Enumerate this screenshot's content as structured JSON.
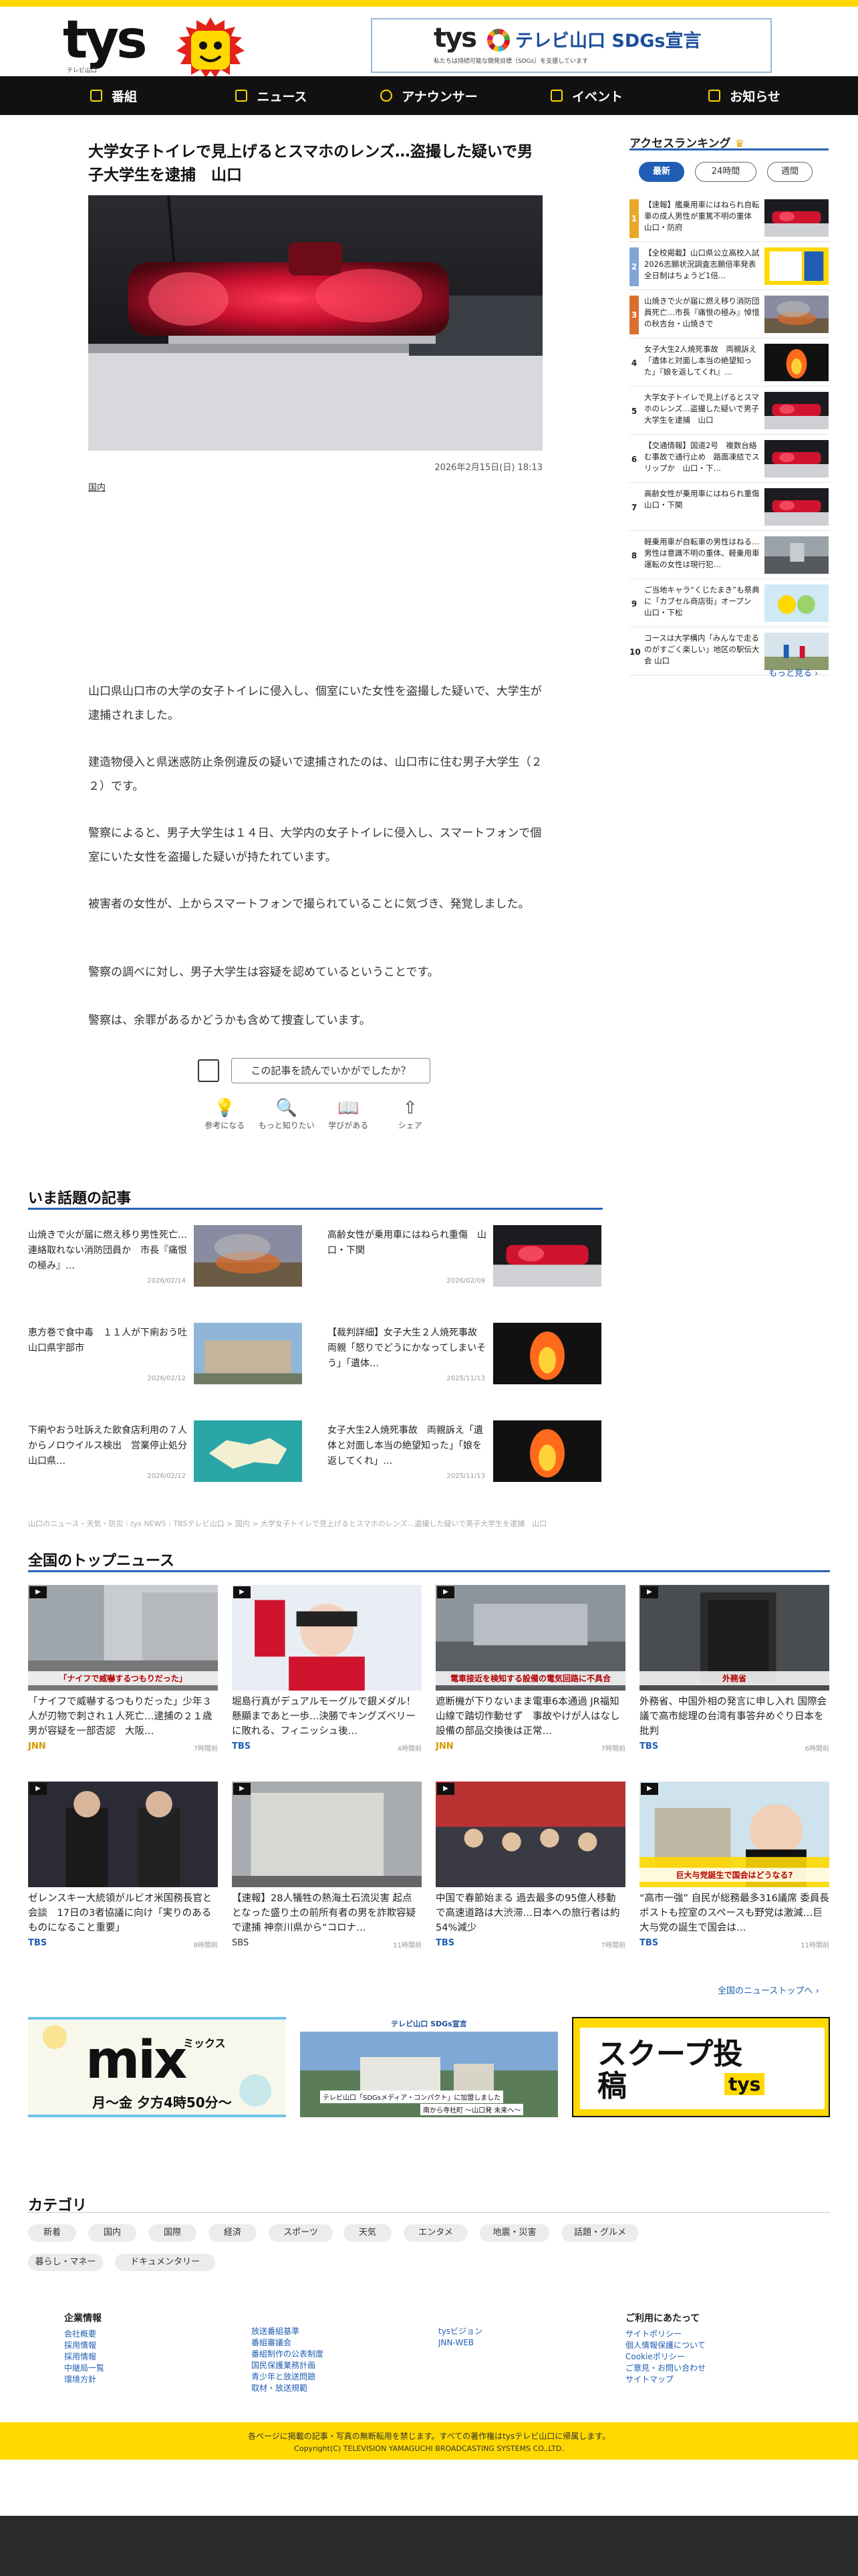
{
  "header": {
    "logo": "tys",
    "logo_sub": "テレビ山口",
    "sdgs": {
      "logo": "tys",
      "title": "テレビ山口 SDGs宣言",
      "small": "私たちは持続可能な開発目標（SDGs）を支援しています"
    }
  },
  "nav": [
    {
      "label": "番組",
      "icon": "tv-icon"
    },
    {
      "label": "ニュース",
      "icon": "news-icon"
    },
    {
      "label": "アナウンサー",
      "icon": "mic-icon"
    },
    {
      "label": "イベント",
      "icon": "megaphone-icon"
    },
    {
      "label": "お知らせ",
      "icon": "bell-icon"
    }
  ],
  "article": {
    "title": "大学女子トイレで見上げるとスマホのレンズ…盗撮した疑いで男子大学生を逮捕　山口",
    "date": "2026年2月15日(日) 18:13",
    "tag": "国内",
    "paragraphs": [
      "山口県山口市の大学の女子トイレに侵入し、個室にいた女性を盗撮した疑いで、大学生が逮捕されました。",
      "建造物侵入と県迷惑防止条例違反の疑いで逮捕されたのは、山口市に住む男子大学生（２２）です。",
      "警察によると、男子大学生は１４日、大学内の女子トイレに侵入し、スマートフォンで個室にいた女性を盗撮した疑いが持たれています。",
      "被害者の女性が、上からスマートフォンで撮られていることに気づき、発覚しました。",
      "警察の調べに対し、男子大学生は容疑を認めているということです。",
      "警察は、余罪があるかどうかも含めて捜査しています。"
    ],
    "survey_label": "この記事を読んでいかがでしたか？",
    "reactions": [
      {
        "label": "参考になる",
        "glyph": "💡",
        "icon": "bulb-icon"
      },
      {
        "label": "もっと知りたい",
        "glyph": "🔍",
        "icon": "magnifier-icon"
      },
      {
        "label": "学びがある",
        "glyph": "📖",
        "icon": "book-icon"
      },
      {
        "label": "シェア",
        "glyph": "⇧",
        "icon": "share-icon"
      }
    ]
  },
  "ranking": {
    "title": "アクセスランキング",
    "tabs": [
      "最新",
      "24時間",
      "週間"
    ],
    "active_tab": "最新",
    "items": [
      {
        "num": "1",
        "text": "【速報】艦乗用車にはねられ自転車の成人男性が重篤不明の重体　山口・防府",
        "thumb": "police"
      },
      {
        "num": "2",
        "text": "【全校掲載】山口県公立高校入試2026志願状況調査志願倍率発表 全日制はちょうど1倍…",
        "thumb": "school"
      },
      {
        "num": "3",
        "text": "山焼きで火が届に燃え移り消防団員死亡…市長『痛恨の極み』悼惜の秋吉台・山焼きで",
        "thumb": "fire"
      },
      {
        "num": "4",
        "text": "女子大生2人焼死事故　両親訴え「遺体と対面し本当の絶望知った」『娘を返してくれ』…",
        "thumb": "fire2"
      },
      {
        "num": "5",
        "text": "大学女子トイレで見上げるとスマホのレンズ…盗撮した疑いで男子大学生を逮捕　山口",
        "thumb": "police"
      },
      {
        "num": "6",
        "text": "【交通情報】国道2号　複数台絡む事故で通行止め　路面凍結でスリップか　山口・下…",
        "thumb": "police"
      },
      {
        "num": "7",
        "text": "高齢女性が乗用車にはねられ重傷　山口・下関",
        "thumb": "police"
      },
      {
        "num": "8",
        "text": "軽乗用車が自転車の男性はねる…男性は意識不明の重体、軽乗用車運転の女性は現行犯…",
        "thumb": "road"
      },
      {
        "num": "9",
        "text": "ご当地キャラ“くじたまき”も祭典に「カブセル商店街」オープン　山口・下松",
        "thumb": "mascot"
      },
      {
        "num": "10",
        "text": "コースは大学構内「みんなで走るのがすごく楽しい」地区の駅伝大会 山口",
        "thumb": "run"
      }
    ],
    "more": "もっと見る ›"
  },
  "wadai": {
    "title": "いま話題の記事",
    "items": [
      {
        "text": "山焼きで火が届に燃え移り男性死亡…連絡取れない消防団員か　市長『痛恨の極み』…",
        "date": "2026/02/14",
        "thumb": "fire"
      },
      {
        "text": "高齢女性が乗用車にはねられ重傷　山口・下関",
        "date": "2026/02/09",
        "thumb": "police"
      },
      {
        "text": "恵方巻で食中毒　１１人が下痢おう吐　山口県宇部市",
        "date": "2026/02/12",
        "thumb": "building"
      },
      {
        "text": "【裁判詳細】女子大生２人焼死事故　両親「怒りでどうにかなってしまいそう」「遺体…",
        "date": "2025/11/13",
        "thumb": "fire2"
      },
      {
        "text": "下痢やおう吐訴えた飲食店利用の７人からノロウイルス検出　営業停止処分　山口県…",
        "date": "2026/02/12",
        "thumb": "map"
      },
      {
        "text": "女子大生2人焼死事故　両親訴え「遺体と対面し本当の絶望知った」「娘を返してくれ」…",
        "date": "2025/11/13",
        "thumb": "fire2"
      }
    ]
  },
  "breadcrumb": "山口のニュース・天気・防災｜tys NEWS｜TBSテレビ山口 > 国内 > 大学女子トイレで見上げるとスマホのレンズ…盗撮した疑いで男子大学生を逮捕　山口",
  "topnews": {
    "title": "全国のトップニュース",
    "items": [
      {
        "text": "「ナイフで威嚇するつもりだった」少年３人が刃物で刺され１人死亡…逮捕の２１歳男が容疑を一部否認　大阪…",
        "source": "JNN",
        "time": "7時間前",
        "thumb": "street",
        "caption": "「ナイフで威嚇するつもりだった」"
      },
      {
        "text": "堀島行真がデュアルモーグルで銀メダル！懸顯まであと一歩…決勝でキングズベリーに敗れる、フィニッシュ後…",
        "source": "TBS",
        "time": "4時間前",
        "thumb": "skier",
        "caption": ""
      },
      {
        "text": "遮断機が下りないまま電車6本通過 JR福知山線で踏切作動せず　事故やけが人はなし　設備の部品交換後は正常…",
        "source": "JNN",
        "time": "7時間前",
        "thumb": "rail",
        "caption": "電車接近を検知する設備の電気回路に不具合"
      },
      {
        "text": "外務省、中国外相の発言に申し入れ 国際会議で高市総理の台湾有事答弁めぐり日本を批判",
        "source": "TBS",
        "time": "6時間前",
        "thumb": "mofa",
        "caption": "外務省"
      },
      {
        "text": "ゼレンスキー大統領がルビオ米国務長官と会談　17日の3者協議に向け「実りのあるものになること重要」",
        "source": "TBS",
        "time": "8時間前",
        "thumb": "meeting",
        "caption": ""
      },
      {
        "text": "【速報】28人犠牲の熱海土石流災害 起点となった盛り土の前所有者の男を詐欺容疑で逮捕 神奈川県から“コロナ…",
        "source": "SBS",
        "time": "11時間前",
        "thumb": "office",
        "caption": ""
      },
      {
        "text": "中国で春節始まる 過去最多の95億人移動で高速道路は大渋滞…日本への旅行者は約54%減少",
        "source": "TBS",
        "time": "7時間前",
        "thumb": "crowd",
        "caption": ""
      },
      {
        "text": "“高市一強” 自民が総務最多316議席 委員長ポストも控室のスペースも野党は激減…巨大与党の誕生で国会は…",
        "source": "TBS",
        "time": "11時間前",
        "thumb": "diet",
        "caption": "巨大与党誕生で国会はどうなる?"
      }
    ],
    "more": "全国のニューストップへ ›"
  },
  "banners": {
    "mix": {
      "title": "mix",
      "sub": "ミックス",
      "time": "月〜金 夕方4時50分〜"
    },
    "sdgs": {
      "title": "テレビ山口 SDGs宣言",
      "caption": "テレビ山口「SDGsメディア・コンパクト」に加盟しました",
      "note": "南から寺社町 〜山口発 未来へ〜"
    },
    "scoop": {
      "title": "スクープ投稿",
      "logo": "tys"
    }
  },
  "category": {
    "title": "カテゴリ",
    "items": [
      "新着",
      "国内",
      "国際",
      "経済",
      "スポーツ",
      "天気",
      "エンタメ",
      "地震・災害",
      "話題・グルメ",
      "暮らし・マネー",
      "ドキュメンタリー"
    ]
  },
  "footer": {
    "col1": {
      "head": "企業情報",
      "links": [
        "会社概要",
        "採用情報",
        "採用情報",
        "中継局一覧",
        "環境方針"
      ]
    },
    "col2": {
      "head": "",
      "links": [
        "放送番組基準",
        "番組審議会",
        "番組制作の公表制度",
        "国民保護業務計画",
        "青少年と放送問題",
        "取材・放送規範"
      ]
    },
    "col3": {
      "head": "",
      "links": [
        "tysビジョン",
        "JNN-WEB"
      ]
    },
    "col4": {
      "head": "ご利用にあたって",
      "links": [
        "サイトポリシー",
        "個人情報保護について",
        "Cookieポリシー",
        "ご意見・お問い合わせ",
        "サイトマップ"
      ]
    },
    "copy1": "各ページに掲載の記事・写真の無断転用を禁じます。すべての著作権はtysテレビ山口に帰属します。",
    "copy2": "Copyright(C) TELEVISION YAMAGUCHI BROADCASTING SYSTEMS CO.,LTD."
  },
  "colors": {
    "accent": "#ffd800",
    "link": "#1f5eb4",
    "nav_bg": "#111111",
    "section_line": "#2563b5"
  }
}
